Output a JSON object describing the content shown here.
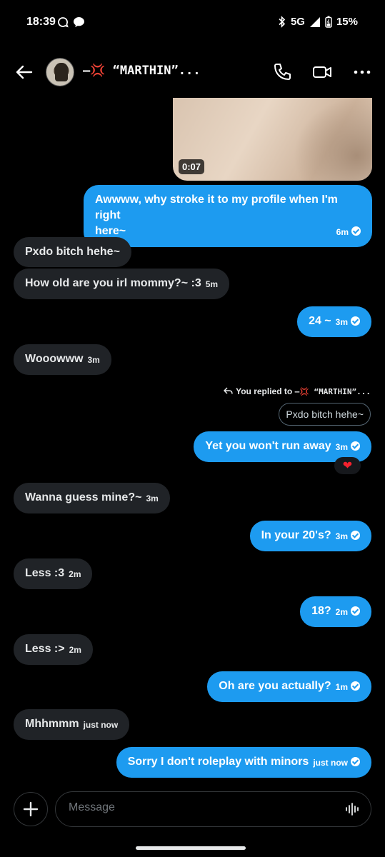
{
  "status_bar": {
    "time": "18:39",
    "network": "5G",
    "battery": "15%",
    "left_icons": [
      "chat-bubble-outline-icon",
      "chat-bubble-filled-icon"
    ],
    "right_icons": [
      "bluetooth-icon",
      "signal-icon",
      "battery-icon"
    ]
  },
  "header": {
    "contact_name": "—💢 “MARTHIN”...",
    "icons": [
      "back-arrow-icon",
      "phone-icon",
      "video-camera-icon",
      "more-dots-icon"
    ]
  },
  "messages": [
    {
      "type": "video",
      "direction": "outgoing",
      "duration": "0:07"
    },
    {
      "direction": "outgoing",
      "lines": [
        "Awwww, why stroke it to my profile when I'm right",
        "here~"
      ],
      "time": "6m",
      "read": true
    },
    {
      "direction": "incoming",
      "text": "Pxdo bitch hehe~",
      "time": ""
    },
    {
      "direction": "incoming",
      "text": "How old are you irl mommy?~ :3",
      "time": "5m"
    },
    {
      "direction": "outgoing",
      "text": "24 ~",
      "time": "3m",
      "read": true
    },
    {
      "direction": "incoming",
      "text": "Wooowww",
      "time": "3m"
    },
    {
      "direction": "outgoing",
      "text": "Yet you won't run away",
      "time": "3m",
      "read": true,
      "reply_to": {
        "label": "You replied to",
        "name": "—💢 “MARTHIN”...",
        "quoted_text": "Pxdo bitch hehe~"
      },
      "reaction": "❤"
    },
    {
      "direction": "incoming",
      "text": "Wanna guess mine?~",
      "time": "3m"
    },
    {
      "direction": "outgoing",
      "text": "In your 20's?",
      "time": "3m",
      "read": true
    },
    {
      "direction": "incoming",
      "text": "Less :3",
      "time": "2m"
    },
    {
      "direction": "outgoing",
      "text": "18?",
      "time": "2m",
      "read": true
    },
    {
      "direction": "incoming",
      "text": "Less :>",
      "time": "2m"
    },
    {
      "direction": "outgoing",
      "text": "Oh are you actually?",
      "time": "1m",
      "read": true
    },
    {
      "direction": "incoming",
      "text": "Mhhmmm",
      "time": "just now"
    },
    {
      "direction": "outgoing",
      "text": "Sorry I don't roleplay with minors",
      "time": "just now",
      "read": true
    }
  ],
  "composer": {
    "placeholder": "Message",
    "icons": [
      "plus-icon",
      "voice-waveform-icon"
    ]
  },
  "colors": {
    "background": "#000000",
    "outgoing_bubble": "#1d9bf0",
    "incoming_bubble": "#202327",
    "reaction": "#f4212e"
  }
}
